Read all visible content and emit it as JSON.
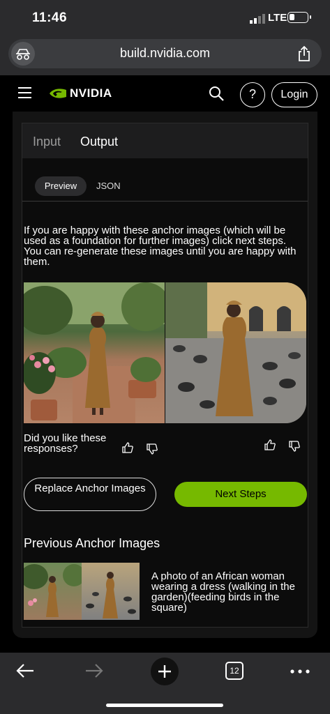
{
  "status": {
    "time": "11:46",
    "network": "LTE"
  },
  "browser": {
    "url": "build.nvidia.com",
    "open_tabs": "12"
  },
  "nav": {
    "brand": "NVIDIA",
    "help_label": "?",
    "login_label": "Login"
  },
  "tabs": {
    "input": "Input",
    "output": "Output"
  },
  "subtabs": {
    "preview": "Preview",
    "json": "JSON"
  },
  "instructions": "If you are happy with these anchor images (which will be used as a foundation for further images) click next steps. You can re-generate these images until you are happy with them.",
  "feedback": {
    "question": "Did you like these responses?"
  },
  "buttons": {
    "replace": "Replace Anchor Images",
    "next": "Next Steps"
  },
  "previous": {
    "title": "Previous Anchor Images",
    "caption": "A photo of an African woman wearing a dress (walking in the garden)(feeding birds in the square)"
  },
  "colors": {
    "accent": "#76b900",
    "background": "#000000",
    "chrome": "#2b2b2d"
  }
}
